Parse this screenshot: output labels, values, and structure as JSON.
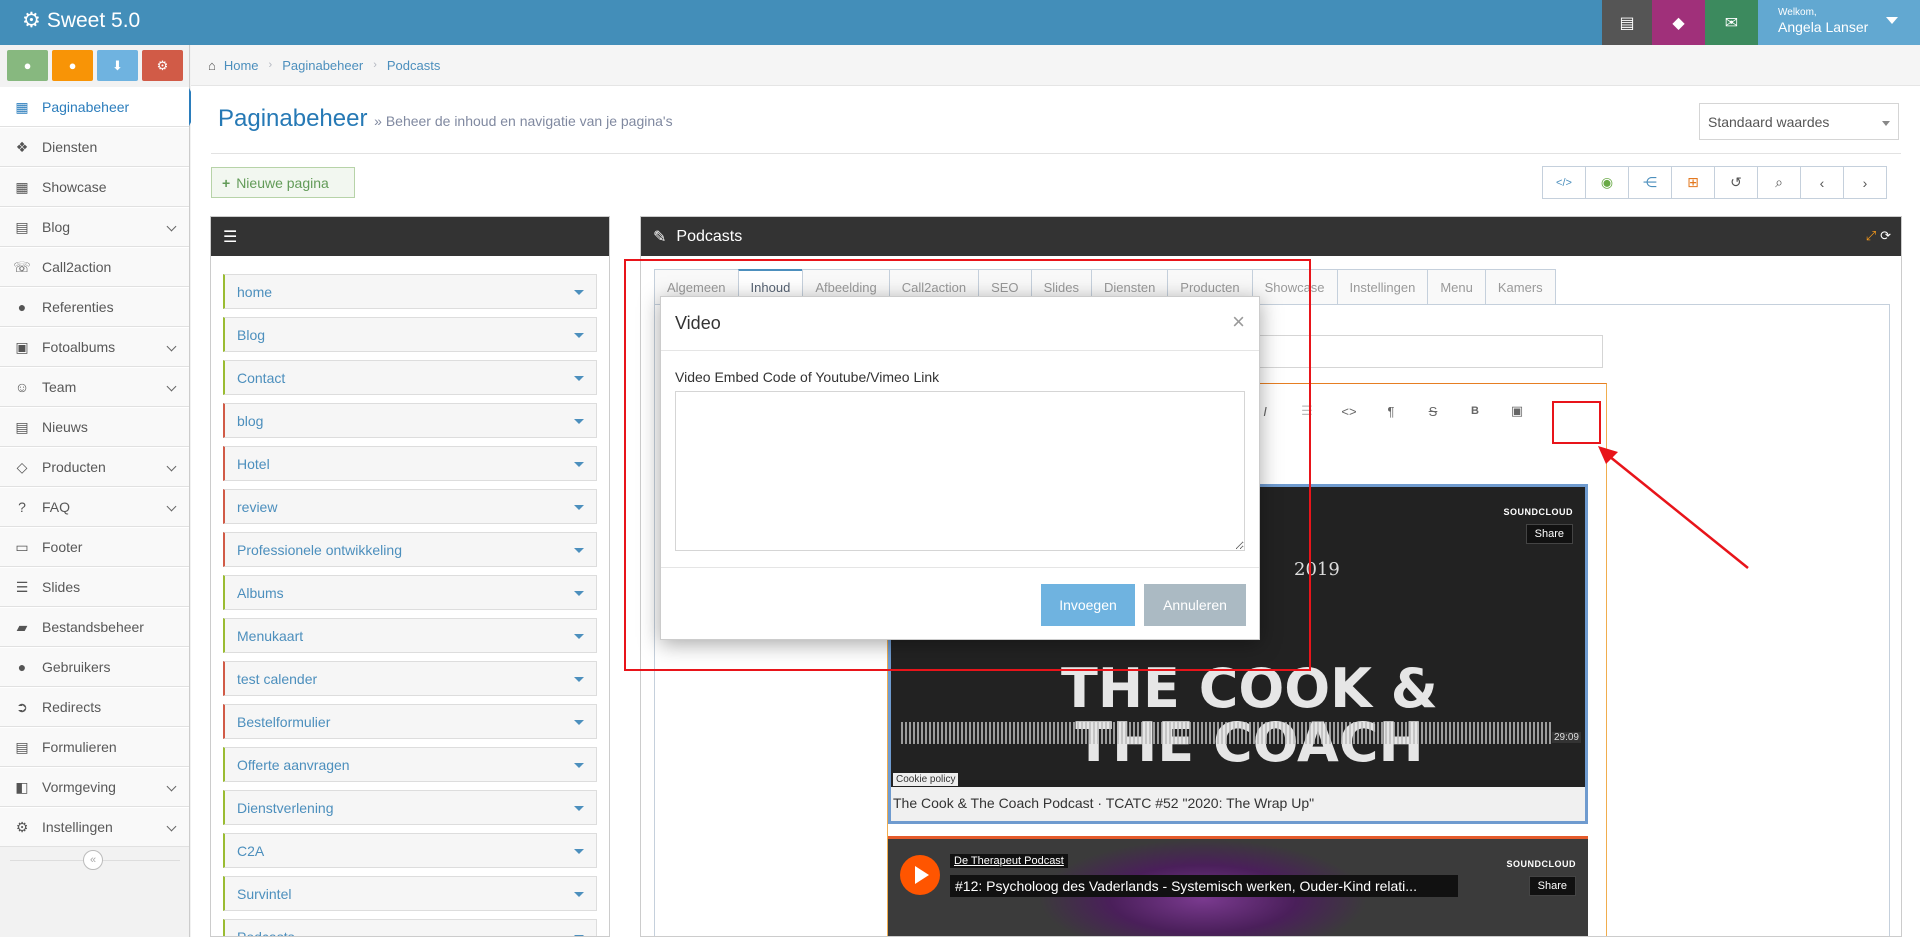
{
  "app": {
    "title": "Sweet 5.0"
  },
  "topbar": {
    "welcome": "Welkom,",
    "user_name": "Angela Lanser",
    "colors": {
      "bar": "#438eb9",
      "btn1": "#555555",
      "btn2": "#a0307a",
      "btn3": "#3c8a5e"
    }
  },
  "shortcuts": [
    {
      "icon": "map-marker-icon",
      "color": "#87b87f"
    },
    {
      "icon": "user-icon",
      "color": "#f89406"
    },
    {
      "icon": "download-icon",
      "color": "#6fb3e0"
    },
    {
      "icon": "cogs-icon",
      "color": "#d15b47"
    }
  ],
  "sidebar": {
    "items": [
      {
        "label": "Paginabeheer",
        "icon": "table-icon",
        "active": true
      },
      {
        "label": "Diensten",
        "icon": "cubes-icon"
      },
      {
        "label": "Showcase",
        "icon": "grid-icon"
      },
      {
        "label": "Blog",
        "icon": "file-icon",
        "submenu": true
      },
      {
        "label": "Call2action",
        "icon": "phone-icon"
      },
      {
        "label": "Referenties",
        "icon": "comments-icon"
      },
      {
        "label": "Fotoalbums",
        "icon": "camera-icon",
        "submenu": true
      },
      {
        "label": "Team",
        "icon": "users-icon",
        "submenu": true
      },
      {
        "label": "Nieuws",
        "icon": "newspaper-icon"
      },
      {
        "label": "Producten",
        "icon": "tags-icon",
        "submenu": true
      },
      {
        "label": "FAQ",
        "icon": "question-icon",
        "submenu": true
      },
      {
        "label": "Footer",
        "icon": "list-alt-icon"
      },
      {
        "label": "Slides",
        "icon": "sliders-icon"
      },
      {
        "label": "Bestandsbeheer",
        "icon": "folder-icon"
      },
      {
        "label": "Gebruikers",
        "icon": "user-icon"
      },
      {
        "label": "Redirects",
        "icon": "arrow-circle-icon"
      },
      {
        "label": "Formulieren",
        "icon": "form-icon"
      },
      {
        "label": "Vormgeving",
        "icon": "layout-icon",
        "submenu": true
      },
      {
        "label": "Instellingen",
        "icon": "gear-icon",
        "submenu": true
      }
    ]
  },
  "breadcrumb": [
    "Home",
    "Paginabeheer",
    "Podcasts"
  ],
  "page": {
    "title": "Paginabeheer",
    "subtitle": "» Beheer de inhoud en navigatie van je pagina's",
    "select_value": "Standaard waardes",
    "new_page_label": "Nieuwe pagina"
  },
  "tree": {
    "items": [
      {
        "label": "home",
        "color": "green"
      },
      {
        "label": "Blog",
        "color": "green"
      },
      {
        "label": "Contact",
        "color": "green"
      },
      {
        "label": "blog",
        "color": "red"
      },
      {
        "label": "Hotel",
        "color": "red"
      },
      {
        "label": "review",
        "color": "red"
      },
      {
        "label": "Professionele ontwikkeling",
        "color": "red"
      },
      {
        "label": "Albums",
        "color": "green"
      },
      {
        "label": "Menukaart",
        "color": "green"
      },
      {
        "label": "test calender",
        "color": "red"
      },
      {
        "label": "Bestelformulier",
        "color": "red"
      },
      {
        "label": "Offerte aanvragen",
        "color": "green"
      },
      {
        "label": "Dienstverlening",
        "color": "green"
      },
      {
        "label": "C2A",
        "color": "green"
      },
      {
        "label": "Survintel",
        "color": "green"
      },
      {
        "label": "Podcasts",
        "color": "green"
      }
    ]
  },
  "editor_panel": {
    "title": "Podcasts",
    "tabs": [
      "Algemeen",
      "Inhoud",
      "Afbeelding",
      "Call2action",
      "SEO",
      "Slides",
      "Diensten",
      "Producten",
      "Showcase",
      "Instellingen",
      "Menu",
      "Kamers"
    ],
    "active_tab": "Inhoud"
  },
  "embed1": {
    "brand": "SOUNDCLOUD",
    "share": "Share",
    "artwork_year": "2019",
    "artwork_line1": "THE COOK &",
    "artwork_line2": "THE COACH",
    "duration": "29:09",
    "cookie": "Cookie policy",
    "caption": "The Cook & The Coach Podcast · TCATC #52 \"2020: The Wrap Up\""
  },
  "embed2": {
    "podcast": "De Therapeut Podcast",
    "title": "#12: Psycholoog des Vaderlands - Systemisch werken, Ouder-Kind relati...",
    "brand": "SOUNDCLOUD",
    "share": "Share"
  },
  "modal": {
    "title": "Video",
    "label": "Video Embed Code of Youtube/Vimeo Link",
    "textarea_value": "",
    "ok_label": "Invoegen",
    "cancel_label": "Annuleren"
  }
}
